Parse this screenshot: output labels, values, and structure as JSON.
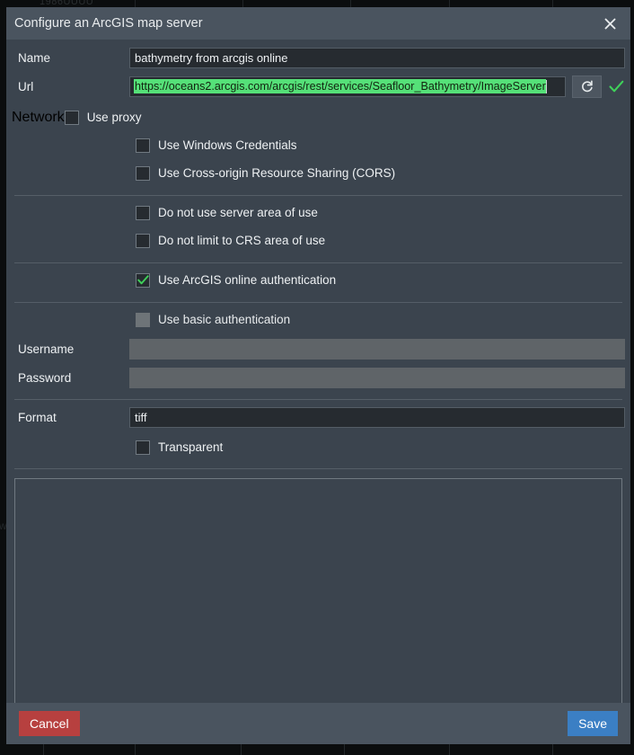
{
  "window": {
    "title": "Configure an ArcGIS map server",
    "close_icon": "close-icon"
  },
  "fields": {
    "name_label": "Name",
    "name_value": "bathymetry from arcgis online",
    "url_label": "Url",
    "url_value": "https://oceans2.arcgis.com/arcgis/rest/services/Seafloor_Bathymetry/ImageServer",
    "url_reset_icon": "reset-icon",
    "url_valid_icon": "check-icon",
    "network_label": "Network",
    "username_label": "Username",
    "username_value": "",
    "password_label": "Password",
    "password_value": "",
    "format_label": "Format",
    "format_value": "tiff"
  },
  "checkboxes": {
    "use_proxy": {
      "label": "Use proxy",
      "checked": false,
      "enabled": true
    },
    "use_windows_credentials": {
      "label": "Use Windows Credentials",
      "checked": false,
      "enabled": true
    },
    "use_cors": {
      "label": "Use Cross-origin Resource Sharing (CORS)",
      "checked": false,
      "enabled": true
    },
    "no_server_area": {
      "label": "Do not use server area of use",
      "checked": false,
      "enabled": true
    },
    "no_crs_area": {
      "label": "Do not limit to CRS area of use",
      "checked": false,
      "enabled": true
    },
    "arcgis_online_auth": {
      "label": "Use ArcGIS online authentication",
      "checked": true,
      "enabled": true
    },
    "basic_auth": {
      "label": "Use basic authentication",
      "checked": false,
      "enabled": false
    },
    "transparent": {
      "label": "Transparent",
      "checked": false,
      "enabled": true
    }
  },
  "layers_panel": {
    "items": []
  },
  "footer": {
    "cancel_label": "Cancel",
    "save_label": "Save"
  },
  "colors": {
    "dialog_bg": "#3b444e",
    "titlebar_bg": "#4a545f",
    "field_bg": "#262b30",
    "selection_green": "#55e078",
    "check_green": "#3fd15a",
    "cancel_red": "#b7403f",
    "save_blue": "#3b7fc4",
    "disabled_grey": "#5f6468"
  }
}
